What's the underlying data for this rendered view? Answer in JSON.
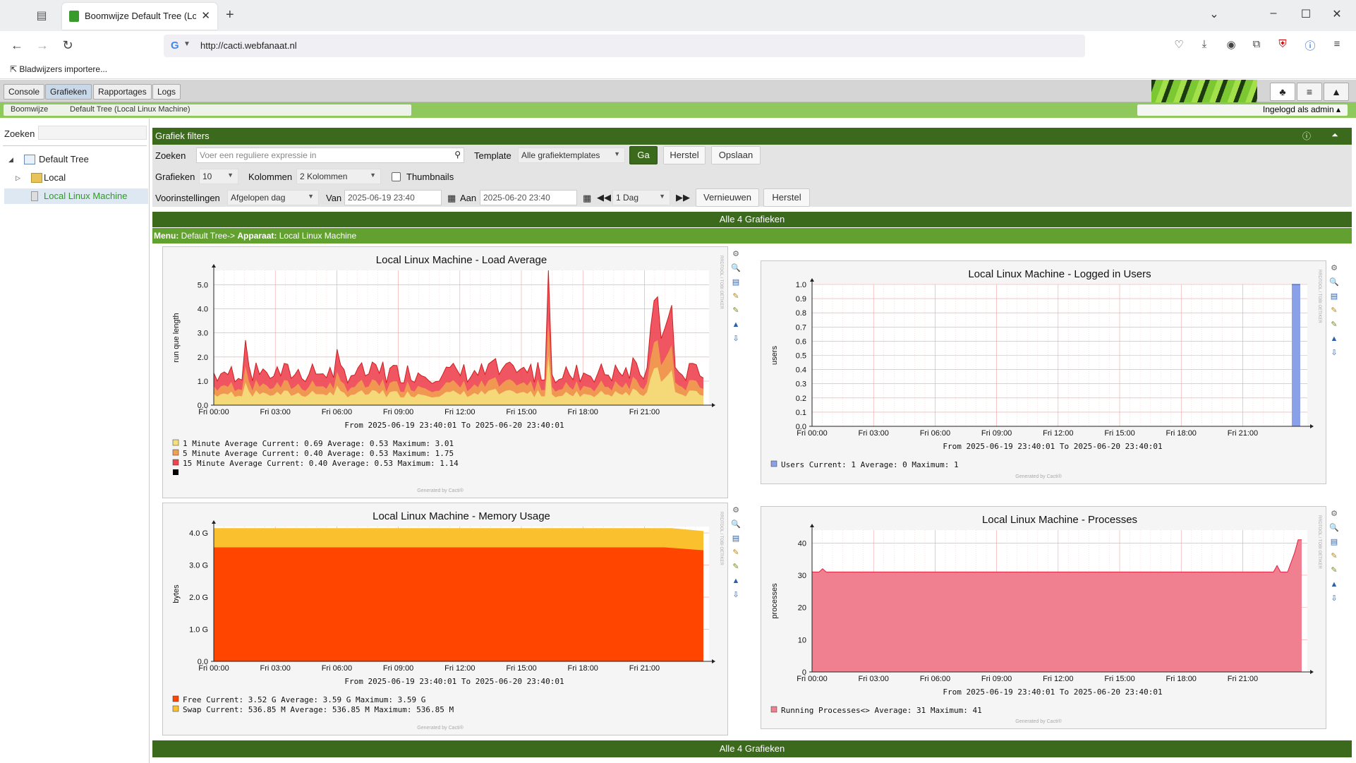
{
  "browser": {
    "tab_title": "Boomwijze Default Tree (Local L",
    "url": "http://cacti.webfanaat.nl",
    "bookmarks_item": "Bladwijzers importere..."
  },
  "cacti": {
    "main_tabs": [
      "Console",
      "Grafieken",
      "Rapportages",
      "Logs"
    ],
    "active_tab": "Grafieken",
    "breadcrumbs": [
      "Boomwijze",
      "Default Tree (Local Linux Machine)"
    ],
    "logged_in": "Ingelogd als admin",
    "colors": {
      "dark_green": "#3b6a1c",
      "light_green": "#8fc85c",
      "accent": "#62a030"
    }
  },
  "sidebar": {
    "search_label": "Zoeken",
    "tree": [
      {
        "label": "Default Tree",
        "icon": "tree-icon"
      },
      {
        "label": "Local",
        "icon": "folder-icon"
      },
      {
        "label": "Local Linux Machine",
        "icon": "host-icon",
        "selected": true
      }
    ]
  },
  "filters": {
    "header": "Grafiek filters",
    "search_label": "Zoeken",
    "search_placeholder": "Voer een reguliere expressie in",
    "template_label": "Template",
    "template_value": "Alle grafiektemplates",
    "go_button": "Ga",
    "reset_button": "Herstel",
    "save_button": "Opslaan",
    "graphs_label": "Grafieken",
    "graphs_value": "10",
    "columns_label": "Kolommen",
    "columns_value": "2 Kolommen",
    "thumbnails_label": "Thumbnails",
    "presets_label": "Voorinstellingen",
    "presets_value": "Afgelopen dag",
    "from_label": "Van",
    "from_value": "2025-06-19 23:40",
    "to_label": "Aan",
    "to_value": "2025-06-20 23:40",
    "shift_value": "1 Dag",
    "refresh_button": "Vernieuwen",
    "reset2_button": "Herstel"
  },
  "bars": {
    "all_graphs": "Alle 4 Grafieken",
    "menu_prefix": "Menu:",
    "menu_tree": "Default Tree->",
    "menu_device_label": "Apparaat:",
    "menu_device": "Local Linux Machine"
  },
  "graph_common": {
    "x_ticks": [
      "Fri 00:00",
      "Fri 03:00",
      "Fri 06:00",
      "Fri 09:00",
      "Fri 12:00",
      "Fri 15:00",
      "Fri 18:00",
      "Fri 21:00"
    ],
    "from_to": "From 2025-06-19 23:40:01 To 2025-06-20 23:40:01",
    "generated_by": "Generated by Cacti®",
    "rrdtool": "RRDTOOL / TOBI OETIKER"
  },
  "chart_data": [
    {
      "type": "area",
      "title": "Local Linux Machine - Load Average",
      "ylabel": "run que length",
      "ylim": [
        0,
        5.6
      ],
      "yticks": [
        "0.0",
        "1.0",
        "2.0",
        "3.0",
        "4.0",
        "5.0"
      ],
      "series": [
        {
          "name": "1 Minute Average",
          "color": "#f5e07c",
          "current": "0.69",
          "average": "0.53",
          "maximum": "3.01"
        },
        {
          "name": "5 Minute Average",
          "color": "#f0a050",
          "current": "0.40",
          "average": "0.53",
          "maximum": "1.75"
        },
        {
          "name": "15 Minute Average",
          "color": "#ee4450",
          "current": "0.40",
          "average": "0.53",
          "maximum": "1.14"
        }
      ],
      "legend_rows": [
        "1 Minute Average   Current:    0.69  Average:    0.53  Maximum:    3.01",
        "5 Minute Average   Current:    0.40  Average:    0.53  Maximum:    1.75",
        "15 Minute Average  Current:    0.40  Average:    0.53  Maximum:    1.14"
      ]
    },
    {
      "type": "area",
      "title": "Local Linux Machine - Logged in Users",
      "ylabel": "users",
      "ylim": [
        0,
        1.0
      ],
      "yticks": [
        "0.0",
        "0.1",
        "0.2",
        "0.3",
        "0.4",
        "0.5",
        "0.6",
        "0.7",
        "0.8",
        "0.9",
        "1.0"
      ],
      "series": [
        {
          "name": "Users",
          "color": "#8aa0e8",
          "current": "1",
          "average": "0",
          "maximum": "1"
        }
      ],
      "legend_rows": [
        "Users  Current:       1  Average:       0  Maximum:       1"
      ]
    },
    {
      "type": "area",
      "title": "Local Linux Machine - Memory Usage",
      "ylabel": "bytes",
      "ylim": [
        0,
        4.2
      ],
      "yticks": [
        "0.0",
        "1.0 G",
        "2.0 G",
        "3.0 G",
        "4.0 G"
      ],
      "series": [
        {
          "name": "Free",
          "color": "#ff4500",
          "current": "3.52 G",
          "average": "3.59 G",
          "maximum": "3.59 G"
        },
        {
          "name": "Swap",
          "color": "#fbc02d",
          "current": "536.85 M",
          "average": "536.85 M",
          "maximum": "536.85 M"
        }
      ],
      "legend_rows": [
        "Free  Current:     3.52 G  Average:     3.59 G  Maximum:     3.59 G",
        "Swap  Current:   536.85 M  Average:   536.85 M  Maximum:   536.85 M"
      ]
    },
    {
      "type": "area",
      "title": "Local Linux Machine - Processes",
      "ylabel": "processes",
      "ylim": [
        0,
        44
      ],
      "yticks": [
        "0",
        "10",
        "20",
        "30",
        "40"
      ],
      "series": [
        {
          "name": "Running Processes<>",
          "color": "#f08090",
          "average": "31",
          "maximum": "41"
        }
      ],
      "legend_rows": [
        "Running Processes<>  Average:      31  Maximum:      41"
      ]
    }
  ]
}
